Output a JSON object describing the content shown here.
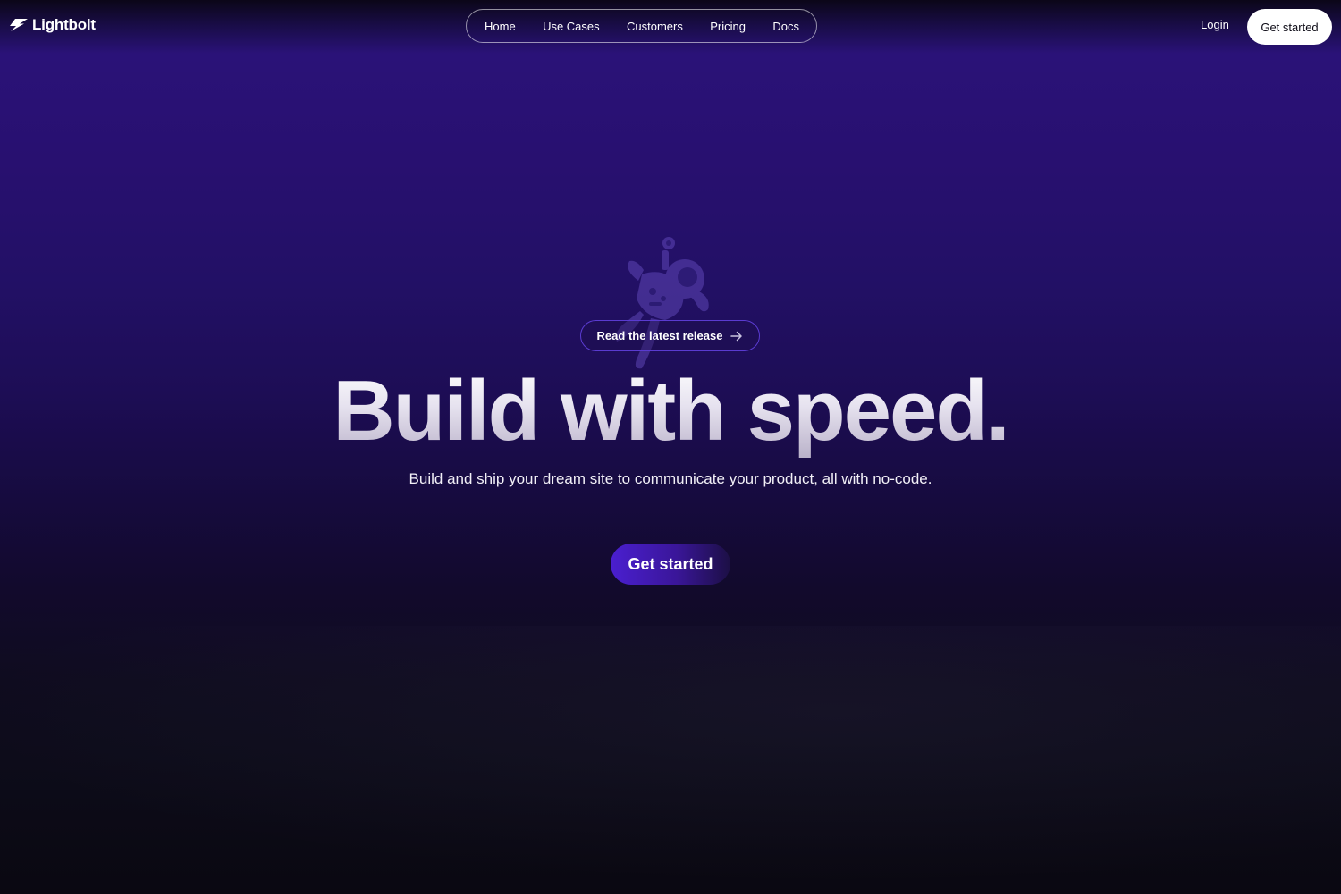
{
  "brand": {
    "name": "Lightbolt",
    "logo_icon": "lightning-bolt-icon"
  },
  "nav": {
    "items": [
      {
        "label": "Home"
      },
      {
        "label": "Use Cases"
      },
      {
        "label": "Customers"
      },
      {
        "label": "Pricing"
      },
      {
        "label": "Docs"
      }
    ],
    "login_label": "Login",
    "cta_label": "Get started"
  },
  "hero": {
    "illustration": "astronaut-illustration",
    "release_link_label": "Read the latest release",
    "release_link_icon": "arrow-right-icon",
    "title": "Build with speed.",
    "subtitle": "Build and ship your dream site to communicate your product, all with no-code.",
    "cta_label": "Get started"
  },
  "colors": {
    "background_top": "#2a1278",
    "background_bottom": "#0a0811",
    "accent": "#4a1fd0",
    "pill_border": "#5a3bd0",
    "header_cta_bg": "#ffffff"
  }
}
